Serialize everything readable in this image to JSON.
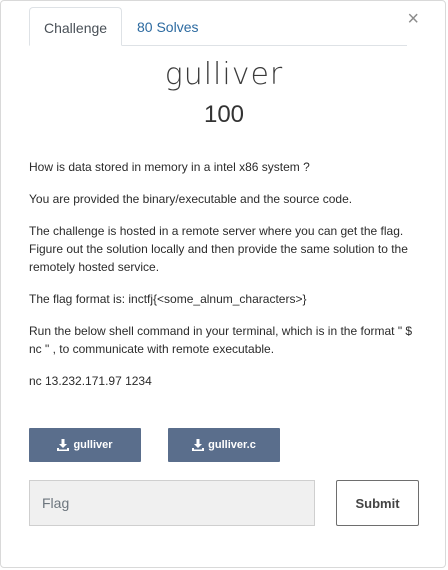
{
  "tabs": [
    {
      "label": "Challenge",
      "active": true
    },
    {
      "label": "80 Solves",
      "active": false
    }
  ],
  "close_glyph": "×",
  "challenge": {
    "name": "gulliver",
    "points": "100",
    "description": [
      "How is data stored in memory in a intel x86 system ?",
      "You are provided the binary/executable and the source code.",
      "The challenge is hosted in a remote server where you can get the flag. Figure out the solution locally and then provide the same solution to the remotely hosted service.",
      "The flag format is: inctfj{<some_alnum_characters>}",
      "Run the below shell command in your terminal, which is in the format \" $ nc \" , to communicate with remote executable.",
      "nc 13.232.171.97 1234"
    ]
  },
  "downloads": [
    {
      "label": "gulliver",
      "icon": "download-icon"
    },
    {
      "label": "gulliver.c",
      "icon": "download-icon"
    }
  ],
  "flag_form": {
    "placeholder": "Flag",
    "value": "",
    "submit_label": "Submit"
  },
  "colors": {
    "accent_link": "#2c6aa0",
    "download_button": "#5a6e8c"
  }
}
